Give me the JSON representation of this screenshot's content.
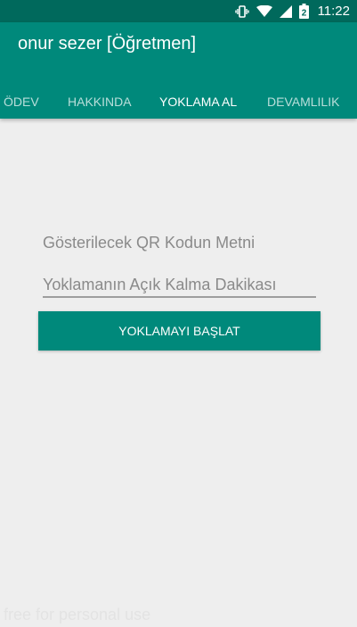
{
  "status_bar": {
    "time": "11:22",
    "battery_level": "2",
    "icons": [
      "vibrate-icon",
      "wifi-icon",
      "signal-icon",
      "battery-icon"
    ]
  },
  "app_bar": {
    "title": "onur sezer [Öğretmen]"
  },
  "tabs": [
    {
      "label": "ÖDEV",
      "active": false
    },
    {
      "label": "HAKKINDA",
      "active": false
    },
    {
      "label": "YOKLAMA AL",
      "active": true
    },
    {
      "label": "DEVAMLILIK",
      "active": false
    }
  ],
  "form": {
    "qr_text_placeholder": "Gösterilecek QR Kodun Metni",
    "minutes_placeholder": "Yoklamanın Açık Kalma Dakikası",
    "start_button_label": "YOKLAMAYI BAŞLAT"
  },
  "watermark": "free for personal use",
  "colors": {
    "primary": "#00897b",
    "primary_dark": "#00695c",
    "background": "#eeeeee"
  }
}
